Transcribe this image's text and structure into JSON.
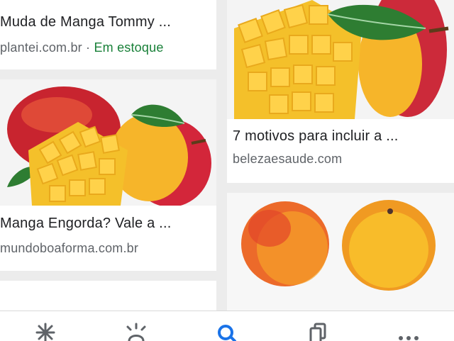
{
  "results": [
    {
      "title": "Muda de Manga Tommy ...",
      "source": "plantei.com.br",
      "separator": " · ",
      "stock": "Em estoque",
      "image": "mango-seedling-image"
    },
    {
      "title": "Manga Engorda? Vale a ...",
      "source": "mundoboaforma.com.br",
      "image": "diced-mango-image"
    },
    {
      "title": "7 motivos para incluir a ...",
      "source": "belezaesaude.com",
      "image": "diced-mango-image"
    },
    {
      "title": "",
      "source": "",
      "image": "halved-mango-image"
    }
  ],
  "bottom_nav": [
    {
      "icon": "discover-icon"
    },
    {
      "icon": "updates-icon"
    },
    {
      "icon": "search-icon",
      "active": true
    },
    {
      "icon": "collections-icon"
    },
    {
      "icon": "more-icon"
    }
  ],
  "colors": {
    "title": "#202124",
    "source": "#5f6368",
    "stock": "#188038",
    "active": "#1a73e8",
    "inactive": "#5f6368"
  }
}
